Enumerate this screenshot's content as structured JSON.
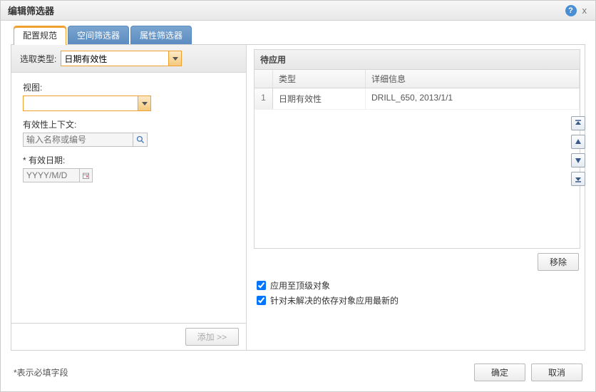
{
  "dialog": {
    "title": "编辑筛选器"
  },
  "tabs": {
    "config": "配置规范",
    "spatial": "空间筛选器",
    "attribute": "属性筛选器"
  },
  "left": {
    "type_label": "选取类型:",
    "type_value": "日期有效性",
    "view_label": "视图:",
    "view_value": "",
    "context_label": "有效性上下文:",
    "context_placeholder": "输入名称或编号",
    "date_label": "* 有效日期:",
    "date_placeholder": "YYYY/M/D",
    "add_button": "添加 >>"
  },
  "pending": {
    "title": "待应用",
    "col_type": "类型",
    "col_detail": "详细信息",
    "rows": [
      {
        "idx": "1",
        "type": "日期有效性",
        "detail": "DRILL_650, 2013/1/1"
      }
    ],
    "remove_button": "移除"
  },
  "checks": {
    "top_level": "应用至顶级对象",
    "unresolved": "针对未解决的依存对象应用最新的"
  },
  "footer": {
    "required": "*表示必填字段",
    "ok": "确定",
    "cancel": "取消"
  }
}
